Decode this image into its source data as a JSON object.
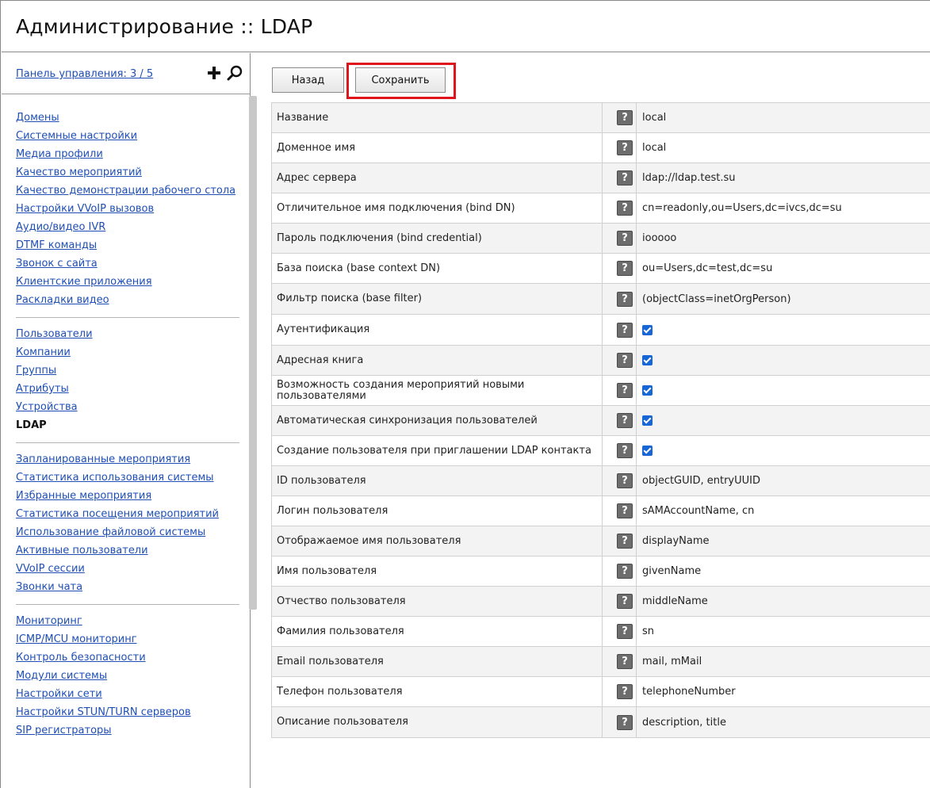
{
  "header": {
    "title": "Администрирование :: LDAP"
  },
  "sidebar": {
    "panel_link": "Панель управления: 3 / 5",
    "groups": [
      [
        {
          "label": "Домены"
        },
        {
          "label": "Системные настройки"
        },
        {
          "label": "Медиа профили"
        },
        {
          "label": "Качество мероприятий"
        },
        {
          "label": "Качество демонстрации рабочего стола"
        },
        {
          "label": "Настройки VVoIP вызовов"
        },
        {
          "label": "Аудио/видео IVR"
        },
        {
          "label": "DTMF команды"
        },
        {
          "label": "Звонок с сайта"
        },
        {
          "label": "Клиентские приложения"
        },
        {
          "label": "Раскладки видео"
        }
      ],
      [
        {
          "label": "Пользователи"
        },
        {
          "label": "Компании"
        },
        {
          "label": "Группы"
        },
        {
          "label": "Атрибуты"
        },
        {
          "label": "Устройства"
        },
        {
          "label": "LDAP",
          "active": true
        }
      ],
      [
        {
          "label": "Запланированные мероприятия"
        },
        {
          "label": "Статистика использования системы"
        },
        {
          "label": "Избранные мероприятия"
        },
        {
          "label": "Статистика посещения мероприятий"
        },
        {
          "label": "Использование файловой системы"
        },
        {
          "label": "Активные пользователи"
        },
        {
          "label": "VVoIP сессии"
        },
        {
          "label": "Звонки чата"
        }
      ],
      [
        {
          "label": "Мониторинг"
        },
        {
          "label": "ICMP/MCU мониторинг"
        },
        {
          "label": "Контроль безопасности"
        },
        {
          "label": "Модули системы"
        },
        {
          "label": "Настройки сети"
        },
        {
          "label": "Настройки STUN/TURN серверов"
        },
        {
          "label": "SIP регистраторы"
        }
      ]
    ]
  },
  "toolbar": {
    "back_label": "Назад",
    "save_label": "Сохранить"
  },
  "settings": [
    {
      "label": "Название",
      "value": "local"
    },
    {
      "label": "Доменное имя",
      "value": "local"
    },
    {
      "label": "Адрес сервера",
      "value": "ldap://ldap.test.su"
    },
    {
      "label": "Отличительное имя подключения (bind DN)",
      "value": "cn=readonly,ou=Users,dc=ivcs,dc=su"
    },
    {
      "label": "Пароль подключения (bind credential)",
      "value": "iooooo"
    },
    {
      "label": "База поиска (base context DN)",
      "value": "ou=Users,dc=test,dc=su"
    },
    {
      "label": "Фильтр поиска (base filter)",
      "value": "(objectClass=inetOrgPerson)"
    },
    {
      "label": "Аутентификация",
      "checkbox": true
    },
    {
      "label": "Адресная книга",
      "checkbox": true
    },
    {
      "label": "Возможность создания мероприятий новыми пользователями",
      "checkbox": true
    },
    {
      "label": "Автоматическая синхронизация пользователей",
      "checkbox": true
    },
    {
      "label": "Создание пользователя при приглашении LDAP контакта",
      "checkbox": true
    },
    {
      "label": "ID пользователя",
      "value": "objectGUID, entryUUID"
    },
    {
      "label": "Логин пользователя",
      "value": "sAMAccountName, cn"
    },
    {
      "label": "Отображаемое имя пользователя",
      "value": "displayName"
    },
    {
      "label": "Имя пользователя",
      "value": "givenName"
    },
    {
      "label": "Отчество пользователя",
      "value": "middleName"
    },
    {
      "label": "Фамилия пользователя",
      "value": "sn"
    },
    {
      "label": "Email пользователя",
      "value": "mail, mMail"
    },
    {
      "label": "Телефон пользователя",
      "value": "telephoneNumber"
    },
    {
      "label": "Описание пользователя",
      "value": "description, title"
    }
  ],
  "help_glyph": "?",
  "colors": {
    "link": "#1f4fb5",
    "highlight": "#e0141b",
    "checkbox": "#1766d6",
    "help_icon_bg": "#6d6d6d"
  },
  "icons": {
    "add": "plus-icon",
    "search": "search-icon",
    "help": "help-icon",
    "checkbox": "checkbox-checked-icon"
  }
}
